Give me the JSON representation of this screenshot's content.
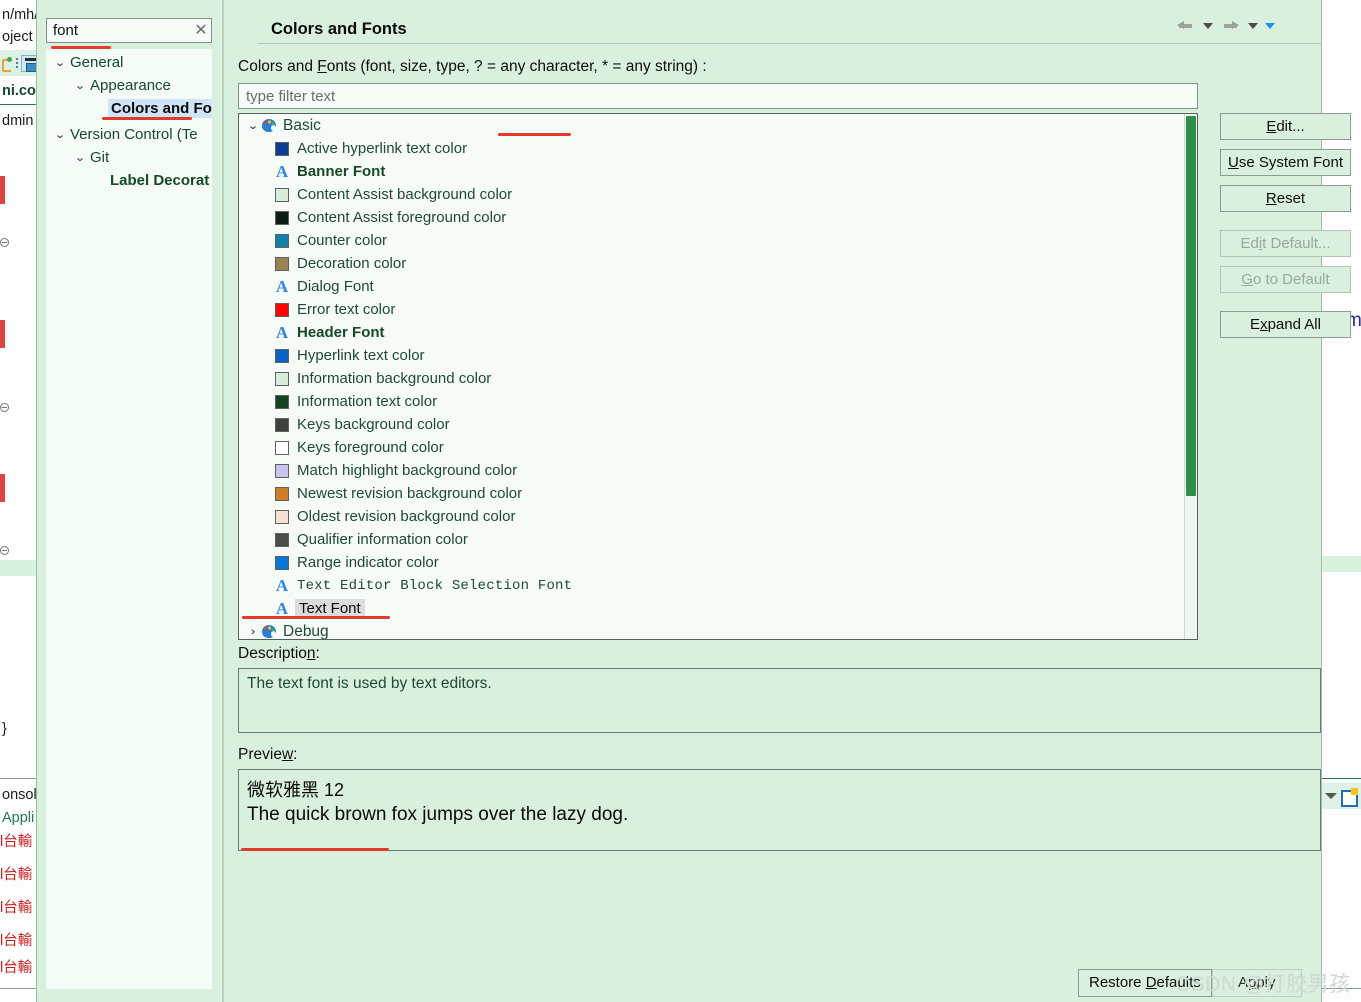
{
  "background": {
    "left_strips": [
      "n/mh/",
      "oject",
      "ni.con",
      "dmin"
    ],
    "left_toolbar_icons": [
      "debug-icon",
      "more-dots-icon",
      "console-select-icon"
    ],
    "console_label": "onsol",
    "console_link": "Appli",
    "console_lines": [
      "l台輸",
      "l台輸",
      "l台輸",
      "l台輸",
      "l台輸"
    ],
    "right_code_fragment": "r lim",
    "right_toolbar_icons": [
      "chevron-down-icon",
      "new-file-icon"
    ]
  },
  "nav": {
    "search_value": "font",
    "search_placeholder": "type filter text",
    "clear_icon": "✕",
    "items": [
      {
        "label": "General",
        "depth": 0,
        "arrow": "⌄",
        "style": "normal"
      },
      {
        "label": "Appearance",
        "depth": 1,
        "arrow": "⌄",
        "style": "normal"
      },
      {
        "label": "Colors and Fo",
        "depth": 2,
        "arrow": "",
        "style": "selected"
      },
      {
        "label": "Version Control (Te",
        "depth": 0,
        "arrow": "⌄",
        "style": "normal"
      },
      {
        "label": "Git",
        "depth": 1,
        "arrow": "⌄",
        "style": "normal"
      },
      {
        "label": "Label Decorat",
        "depth": 2,
        "arrow": "",
        "style": "bold"
      }
    ]
  },
  "header": {
    "title": "Colors and Fonts",
    "nav_icons": [
      "back-arrow-icon",
      "back-dropdown-icon",
      "forward-arrow-icon",
      "forward-dropdown-icon",
      "menu-dropdown-icon"
    ]
  },
  "main": {
    "description_line_pre": "Colors and ",
    "description_line_mnemonic": "F",
    "description_line_post": "onts (font, size, type, ? = any character, * = any string) :",
    "filter_placeholder": "type filter text",
    "filter_value": "",
    "tree": [
      {
        "type": "category",
        "label": "Basic",
        "twisty": "⌄",
        "icon": "palette-icon",
        "underlined": true
      },
      {
        "type": "color",
        "label": "Active hyperlink text color",
        "color": "#0b3d91"
      },
      {
        "type": "font",
        "label": "Banner Font",
        "bold": true
      },
      {
        "type": "color",
        "label": "Content Assist background color",
        "color": "#d6edd9"
      },
      {
        "type": "color",
        "label": "Content Assist foreground color",
        "color": "#0d1a0f"
      },
      {
        "type": "color",
        "label": "Counter color",
        "color": "#1380a8"
      },
      {
        "type": "color",
        "label": "Decoration color",
        "color": "#9b8253"
      },
      {
        "type": "font",
        "label": "Dialog Font",
        "bold": false
      },
      {
        "type": "color",
        "label": "Error text color",
        "color": "#fb0606"
      },
      {
        "type": "font",
        "label": "Header Font",
        "bold": true
      },
      {
        "type": "color",
        "label": "Hyperlink text color",
        "color": "#0a63c4"
      },
      {
        "type": "color",
        "label": "Information background color",
        "color": "#d6edd9"
      },
      {
        "type": "color",
        "label": "Information text color",
        "color": "#14441f"
      },
      {
        "type": "color",
        "label": "Keys background color",
        "color": "#3d423f"
      },
      {
        "type": "color",
        "label": "Keys foreground color",
        "color": "#ffffff"
      },
      {
        "type": "color",
        "label": "Match highlight background color",
        "color": "#c8c4ef"
      },
      {
        "type": "color",
        "label": "Newest revision background color",
        "color": "#cb7f2a"
      },
      {
        "type": "color",
        "label": "Oldest revision background color",
        "color": "#f6e0d3"
      },
      {
        "type": "color",
        "label": "Qualifier information color",
        "color": "#4a4f4c"
      },
      {
        "type": "color",
        "label": "Range indicator color",
        "color": "#0a76d8"
      },
      {
        "type": "font",
        "label": "Text Editor Block Selection Font",
        "mono": true
      },
      {
        "type": "font",
        "label": "Text Font",
        "selected": true,
        "underlined": true
      },
      {
        "type": "category",
        "label": "Debug",
        "twisty": "›",
        "icon": "palette-icon",
        "clipped": true
      }
    ],
    "buttons": [
      {
        "label": "Edit...",
        "mnemonic": "E",
        "enabled": true
      },
      {
        "label": "Use System Font",
        "mnemonic": "U",
        "enabled": true
      },
      {
        "label": "Reset",
        "mnemonic": "R",
        "enabled": true
      },
      {
        "label": "Edit Default...",
        "mnemonic": "i",
        "enabled": false
      },
      {
        "label": "Go to Default",
        "mnemonic": "G",
        "enabled": false
      },
      {
        "label": "Expand All",
        "mnemonic": "x",
        "enabled": true
      }
    ]
  },
  "description": {
    "label_pre": "Descriptio",
    "label_mnemonic": "n",
    "label_post": ":",
    "text": "The text font is used by text editors."
  },
  "preview": {
    "label_pre": "Previe",
    "label_mnemonic": "w",
    "label_post": ":",
    "line1": "微软雅黑 12",
    "line2": "The quick brown fox jumps over the lazy dog."
  },
  "footer": {
    "restore_defaults_pre": "Restore ",
    "restore_defaults_mnemonic": "D",
    "restore_defaults_post": "efaults",
    "apply_pre": "A",
    "apply_mnemonic": "p",
    "apply_post": "ply",
    "watermark": "CSDN @打胶男孩"
  },
  "colors": {
    "dialog_bg": "#d9f0de",
    "field_bg": "#f7fbf8",
    "annotation_red": "#e23b2e",
    "selection_blue": "#cfe4f7",
    "selection_gray": "#dcdcdc",
    "scrollbar_thumb": "#2f8f4a"
  }
}
